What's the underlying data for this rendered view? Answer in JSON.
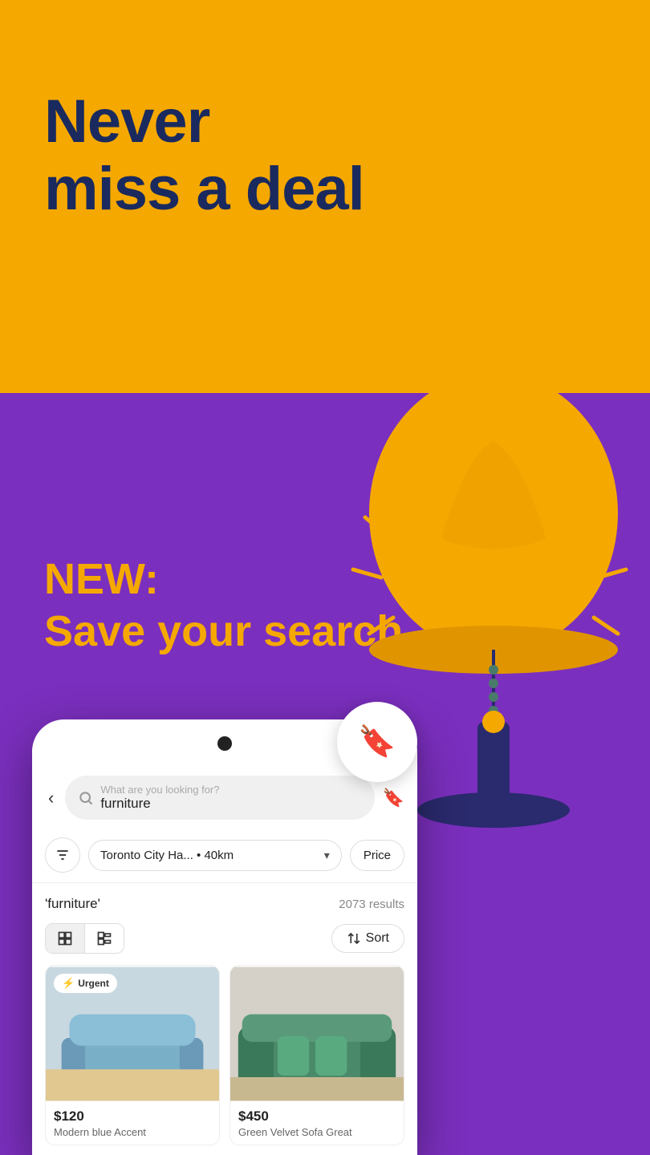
{
  "hero": {
    "title_line1": "Never",
    "title_line2": "miss a deal",
    "bg_top": "#F5A800",
    "bg_bottom": "#7B2FBE"
  },
  "new_section": {
    "new_label": "NEW:",
    "save_label": "Save your search."
  },
  "phone": {
    "search_placeholder": "What are you looking for?",
    "search_value": "furniture",
    "location": "Toronto City Ha... • 40km",
    "price_label": "Price",
    "query_label": "'furniture'",
    "results_count": "2073 results",
    "sort_label": "Sort",
    "view_grid_label": "grid",
    "view_list_label": "list"
  },
  "products": [
    {
      "price": "$120",
      "name": "Modern blue Accent",
      "urgent": true,
      "color1": "#7aafc8",
      "color2": "#5a90b0"
    },
    {
      "price": "$450",
      "name": "Green Velvet Sofa Great",
      "urgent": false,
      "color1": "#4a8a6a",
      "color2": "#357055"
    }
  ]
}
